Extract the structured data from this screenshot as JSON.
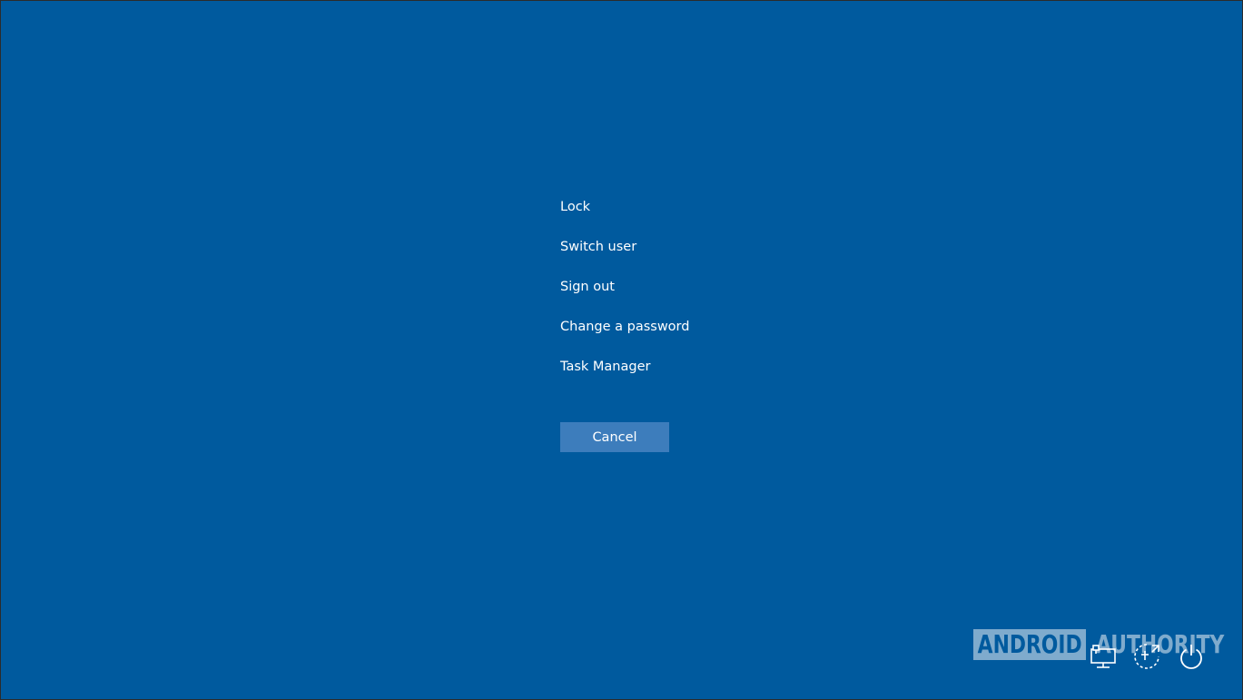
{
  "menu": {
    "items": [
      {
        "label": "Lock"
      },
      {
        "label": "Switch user"
      },
      {
        "label": "Sign out"
      },
      {
        "label": "Change a password"
      },
      {
        "label": "Task Manager"
      }
    ],
    "cancel_label": "Cancel"
  },
  "watermark": {
    "boxed_text": "ANDROID",
    "plain_text": "AUTHORITY"
  },
  "system_icons": [
    "network-icon",
    "ease-of-access-icon",
    "power-icon"
  ],
  "colors": {
    "background": "#005a9e",
    "button": "#3d7dbc",
    "text": "#ffffff"
  }
}
